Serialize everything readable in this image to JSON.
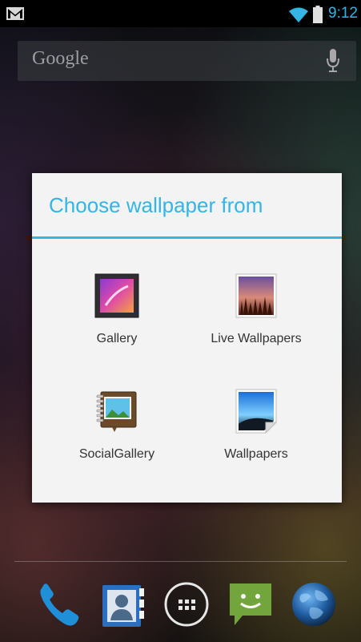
{
  "status_bar": {
    "time": "9:12",
    "colors": {
      "accent": "#33b5e5"
    },
    "icons": [
      "gmail-icon",
      "wifi-icon",
      "battery-icon"
    ]
  },
  "search_bar": {
    "logo_text": "Google",
    "icons": [
      "mic-icon"
    ]
  },
  "dialog": {
    "title": "Choose wallpaper from",
    "accent_color": "#33b5e5",
    "options": [
      {
        "label": "Gallery",
        "icon": "gallery-icon"
      },
      {
        "label": "Live Wallpapers",
        "icon": "live-wallpapers-icon"
      },
      {
        "label": "SocialGallery",
        "icon": "social-gallery-icon"
      },
      {
        "label": "Wallpapers",
        "icon": "wallpapers-icon"
      }
    ]
  },
  "dock": {
    "items": [
      {
        "icon": "phone-icon"
      },
      {
        "icon": "contacts-icon"
      },
      {
        "icon": "app-drawer-icon"
      },
      {
        "icon": "messaging-icon"
      },
      {
        "icon": "browser-icon"
      }
    ]
  }
}
